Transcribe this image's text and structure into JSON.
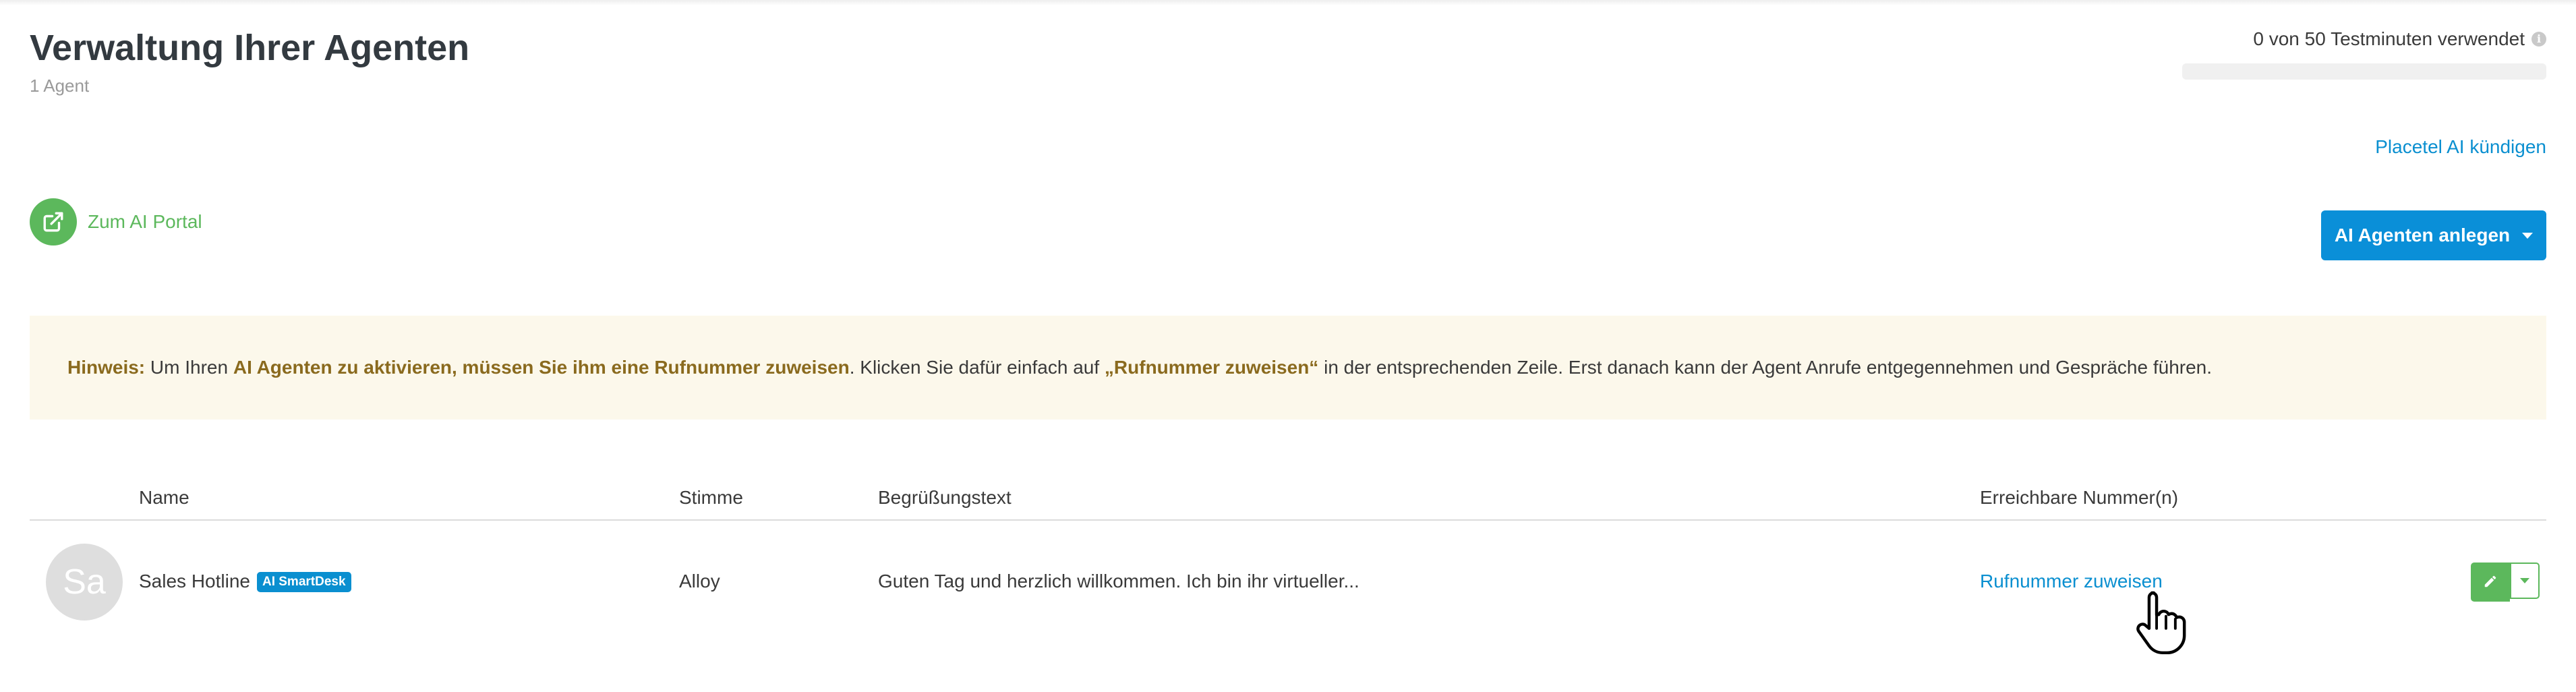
{
  "header": {
    "title": "Verwaltung Ihrer Agenten",
    "subtitle": "1 Agent",
    "usage_text": "0 von 50 Testminuten verwendet",
    "usage_fraction": 0,
    "cancel_link": "Placetel AI kündigen"
  },
  "actions": {
    "portal_label": "Zum AI Portal",
    "create_label": "AI Agenten anlegen"
  },
  "notice": {
    "hint_label": "Hinweis:",
    "t1": " Um Ihren ",
    "b1": "AI Agenten zu aktivieren, müssen Sie ihm eine Rufnummer zuweisen",
    "t2": ". Klicken Sie dafür einfach auf ",
    "b2": "„Rufnummer zuweisen“",
    "t3": " in der entsprechenden Zeile. Erst danach kann der Agent Anrufe entgegennehmen und Gespräche führen."
  },
  "table": {
    "columns": [
      "Name",
      "Stimme",
      "Begrüßungstext",
      "Erreichbare Nummer(n)"
    ],
    "rows": [
      {
        "avatar": "Sa",
        "name": "Sales Hotline",
        "badge": "AI SmartDesk",
        "voice": "Alloy",
        "greeting": "Guten Tag und herzlich willkommen. Ich bin ihr virtueller...",
        "numbers_link": "Rufnummer zuweisen"
      }
    ]
  },
  "colors": {
    "accent_blue": "#0a8fd8",
    "green": "#5cb85c",
    "notice_bg": "#fcf8eb",
    "notice_bold": "#8a6a1e"
  }
}
